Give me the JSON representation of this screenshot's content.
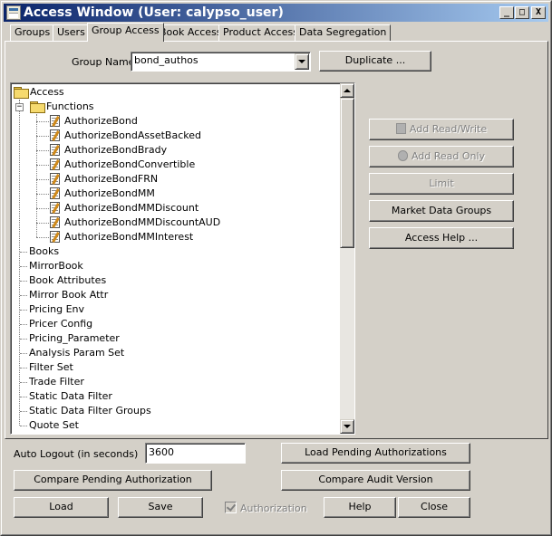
{
  "window": {
    "title": "Access Window (User: calypso_user)",
    "controls": {
      "minimize": "_",
      "maximize": "□",
      "close": "X"
    }
  },
  "tabs": [
    "Groups",
    "Users",
    "Group Access",
    "Book Access",
    "Product Access",
    "Data Segregation"
  ],
  "active_tab": "Group Access",
  "group_name": {
    "label": "Group Name",
    "value": "bond_authos"
  },
  "duplicate_button": "Duplicate ...",
  "tree": {
    "root": "Access",
    "functions_node": "Functions",
    "functions": [
      "AuthorizeBond",
      "AuthorizeBondAssetBacked",
      "AuthorizeBondBrady",
      "AuthorizeBondConvertible",
      "AuthorizeBondFRN",
      "AuthorizeBondMM",
      "AuthorizeBondMMDiscount",
      "AuthorizeBondMMDiscountAUD",
      "AuthorizeBondMMInterest"
    ],
    "nodes": [
      "Books",
      "MirrorBook",
      "Book Attributes",
      "Mirror Book Attr",
      "Pricing Env",
      "Pricer Config",
      "Pricing_Parameter",
      "Analysis Param Set",
      "Filter Set",
      "Trade Filter",
      "Static Data Filter",
      "Static Data Filter Groups",
      "Quote Set"
    ]
  },
  "side_buttons": {
    "add_read_write": "Add Read/Write",
    "add_read_only": "Add Read Only",
    "limit": "Limit",
    "market_data_groups": "Market Data Groups",
    "access_help": "Access Help ..."
  },
  "auto_logout": {
    "label": "Auto Logout (in seconds)",
    "value": "3600"
  },
  "bottom_buttons": {
    "load_pending": "Load Pending Authorizations",
    "compare_pending": "Compare Pending Authorization",
    "compare_audit": "Compare Audit Version",
    "load": "Load",
    "save": "Save",
    "help": "Help",
    "close": "Close"
  },
  "authorization_checkbox": {
    "label": "Authorization",
    "checked": true,
    "enabled": false
  }
}
